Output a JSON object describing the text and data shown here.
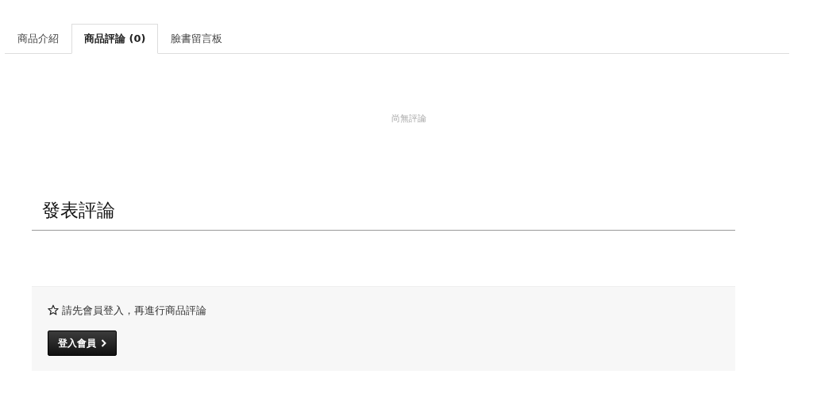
{
  "tabs": [
    {
      "label": "商品介紹",
      "selected": false
    },
    {
      "label": "商品評論 (0)",
      "selected": true
    },
    {
      "label": "臉書留言板",
      "selected": false
    }
  ],
  "reviews": {
    "empty_text": "尚無評論"
  },
  "write_review": {
    "heading": "發表評論",
    "notice": "請先會員登入，再進行商品評論",
    "login_button": "登入會員"
  }
}
